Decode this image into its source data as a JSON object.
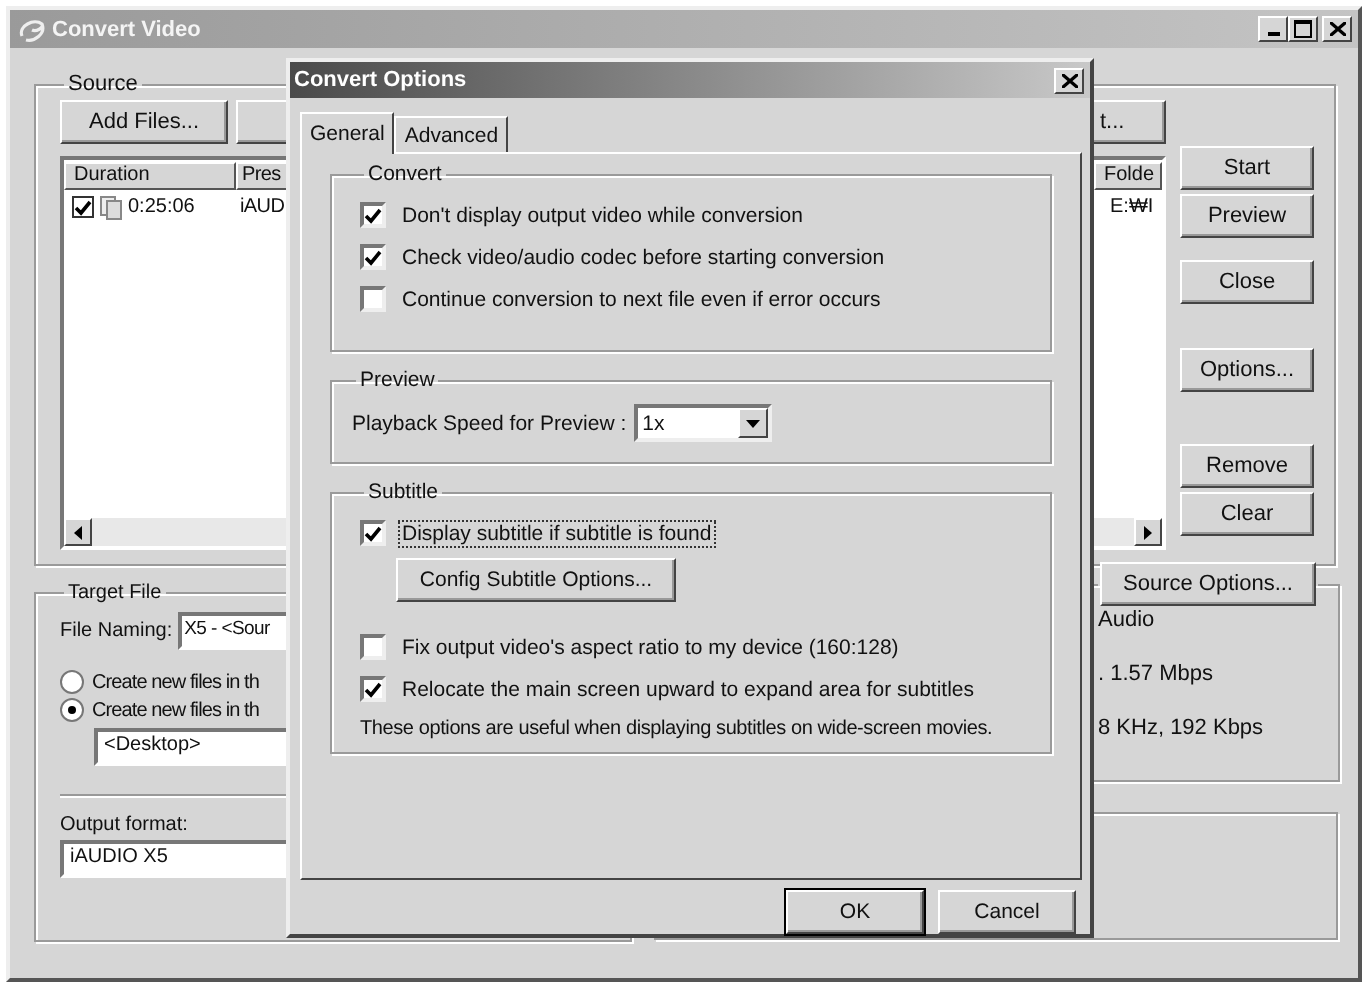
{
  "main_window": {
    "title": "Convert Video"
  },
  "source": {
    "label": "Source",
    "buttons": [
      "Add Files...",
      "t..."
    ],
    "list": {
      "columns": [
        "Duration",
        "Pres",
        "Folde"
      ],
      "rows": [
        {
          "checked": true,
          "cells": [
            "0:25:06",
            "iAUD",
            "E:₩I"
          ]
        }
      ]
    }
  },
  "side_buttons": [
    [
      "Start",
      "Preview"
    ],
    [
      "Close"
    ],
    [
      "Options..."
    ],
    [
      "Remove",
      "Clear"
    ]
  ],
  "target_file": {
    "label": "Target File",
    "file_naming": {
      "label": "File Naming:",
      "value": "X5 - <Sour"
    },
    "location_options": [
      {
        "label": "Create new files in th",
        "selected": false
      },
      {
        "label": "Create new files in th",
        "selected": true
      }
    ],
    "folder": {
      "value": "<Desktop>"
    },
    "output_format": {
      "label": "Output format:",
      "value": "iAUDIO X5"
    }
  },
  "source_info": {
    "button": "Source Options...",
    "lines": [
      "Audio",
      ". 1.57 Mbps",
      "8 KHz, 192 Kbps"
    ]
  },
  "dialog": {
    "title": "Convert Options",
    "tabs": [
      {
        "label": "General",
        "selected": true
      },
      {
        "label": "Advanced",
        "selected": false
      }
    ],
    "groups": [
      {
        "label": "Convert",
        "items": [
          {
            "kind": "checkbox",
            "label": "Don't display output video while conversion",
            "checked": true,
            "focused": false
          },
          {
            "kind": "checkbox",
            "label": "Check video/audio codec before starting conversion",
            "checked": true,
            "focused": false
          },
          {
            "kind": "checkbox",
            "label": "Continue conversion to next file even if error occurs",
            "checked": false,
            "focused": false
          }
        ]
      },
      {
        "label": "Preview",
        "items": [
          {
            "kind": "dropdown",
            "label": "Playback Speed for Preview :",
            "value": "1x"
          }
        ]
      },
      {
        "label": "Subtitle",
        "items": [
          {
            "kind": "checkbox",
            "label": "Display subtitle if subtitle is found",
            "checked": true,
            "focused": true
          },
          {
            "kind": "button",
            "label": "Config Subtitle Options..."
          },
          {
            "kind": "checkbox",
            "label": "Fix output video's aspect ratio to my device (160:128)",
            "checked": false,
            "focused": false
          },
          {
            "kind": "checkbox",
            "label": "Relocate the main screen upward to expand area for subtitles",
            "checked": true,
            "focused": false
          },
          {
            "kind": "note",
            "label": "These options are useful when displaying subtitles on wide-screen movies."
          }
        ]
      }
    ],
    "buttons": [
      "OK",
      "Cancel"
    ]
  }
}
